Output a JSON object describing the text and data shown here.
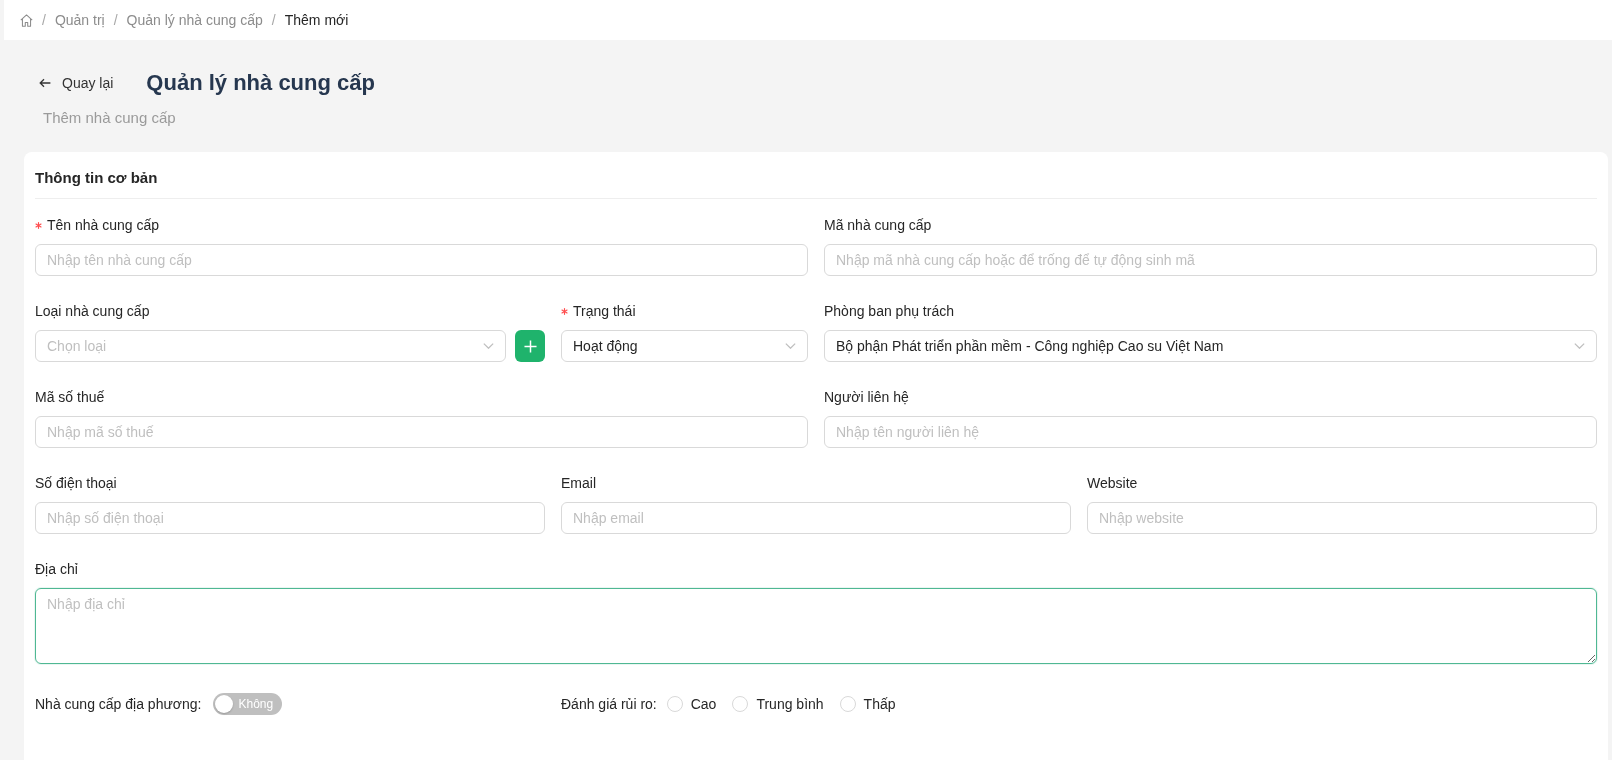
{
  "breadcrumb": {
    "items": [
      {
        "separator": "/",
        "label": "Quản trị",
        "current": false
      },
      {
        "separator": "/",
        "label": "Quản lý nhà cung cấp",
        "current": false
      },
      {
        "separator": "/",
        "label": "Thêm mới",
        "current": true
      }
    ]
  },
  "header": {
    "back_label": "Quay lại",
    "title": "Quản lý nhà cung cấp",
    "subtitle": "Thêm nhà cung cấp"
  },
  "form": {
    "title": "Thông tin cơ bản",
    "rows": [
      [
        {
          "kind": "input",
          "label": "Tên nhà cung cấp",
          "required": true,
          "focused": false,
          "placeholder": "Nhập tên nhà cung cấp"
        },
        {
          "kind": "input",
          "label": "Mã nhà cung cấp",
          "required": false,
          "focused": false,
          "placeholder": "Nhập mã nhà cung cấp hoặc để trống để tự động sinh mã"
        }
      ],
      [
        {
          "kind": "select",
          "label": "Loại nhà cung cấp",
          "required": false,
          "focused": false,
          "placeholder": "Chọn loại",
          "add_button": true
        },
        {
          "kind": "select",
          "label": "Trạng thái",
          "required": true,
          "focused": false,
          "value": "Hoạt động"
        },
        {
          "kind": "select",
          "label": "Phòng ban phụ trách",
          "required": false,
          "focused": false,
          "value": "Bộ phận Phát triển phần mềm - Công nghiệp Cao su Việt Nam"
        }
      ],
      [
        {
          "kind": "input",
          "label": "Mã số thuế",
          "required": false,
          "focused": false,
          "placeholder": "Nhập mã số thuế"
        },
        {
          "kind": "input",
          "label": "Người liên hệ",
          "required": false,
          "focused": false,
          "placeholder": "Nhập tên người liên hệ"
        }
      ],
      [
        {
          "kind": "input",
          "label": "Số điện thoại",
          "required": false,
          "focused": false,
          "placeholder": "Nhập số điện thoại"
        },
        {
          "kind": "input",
          "label": "Email",
          "required": false,
          "focused": false,
          "placeholder": "Nhập email"
        },
        {
          "kind": "input",
          "label": "Website",
          "required": false,
          "focused": false,
          "placeholder": "Nhập website"
        }
      ],
      [
        {
          "kind": "textarea",
          "label": "Địa chỉ",
          "required": false,
          "focused": true,
          "placeholder": "Nhập địa chỉ"
        }
      ]
    ],
    "local_supplier": {
      "label": "Nhà cung cấp địa phương:",
      "on": false,
      "text": "Không"
    },
    "risk_rating": {
      "label": "Đánh giá rủi ro:",
      "options": [
        {
          "label": "Cao",
          "selected": false
        },
        {
          "label": "Trung bình",
          "selected": false
        },
        {
          "label": "Thấp",
          "selected": false
        }
      ]
    }
  }
}
